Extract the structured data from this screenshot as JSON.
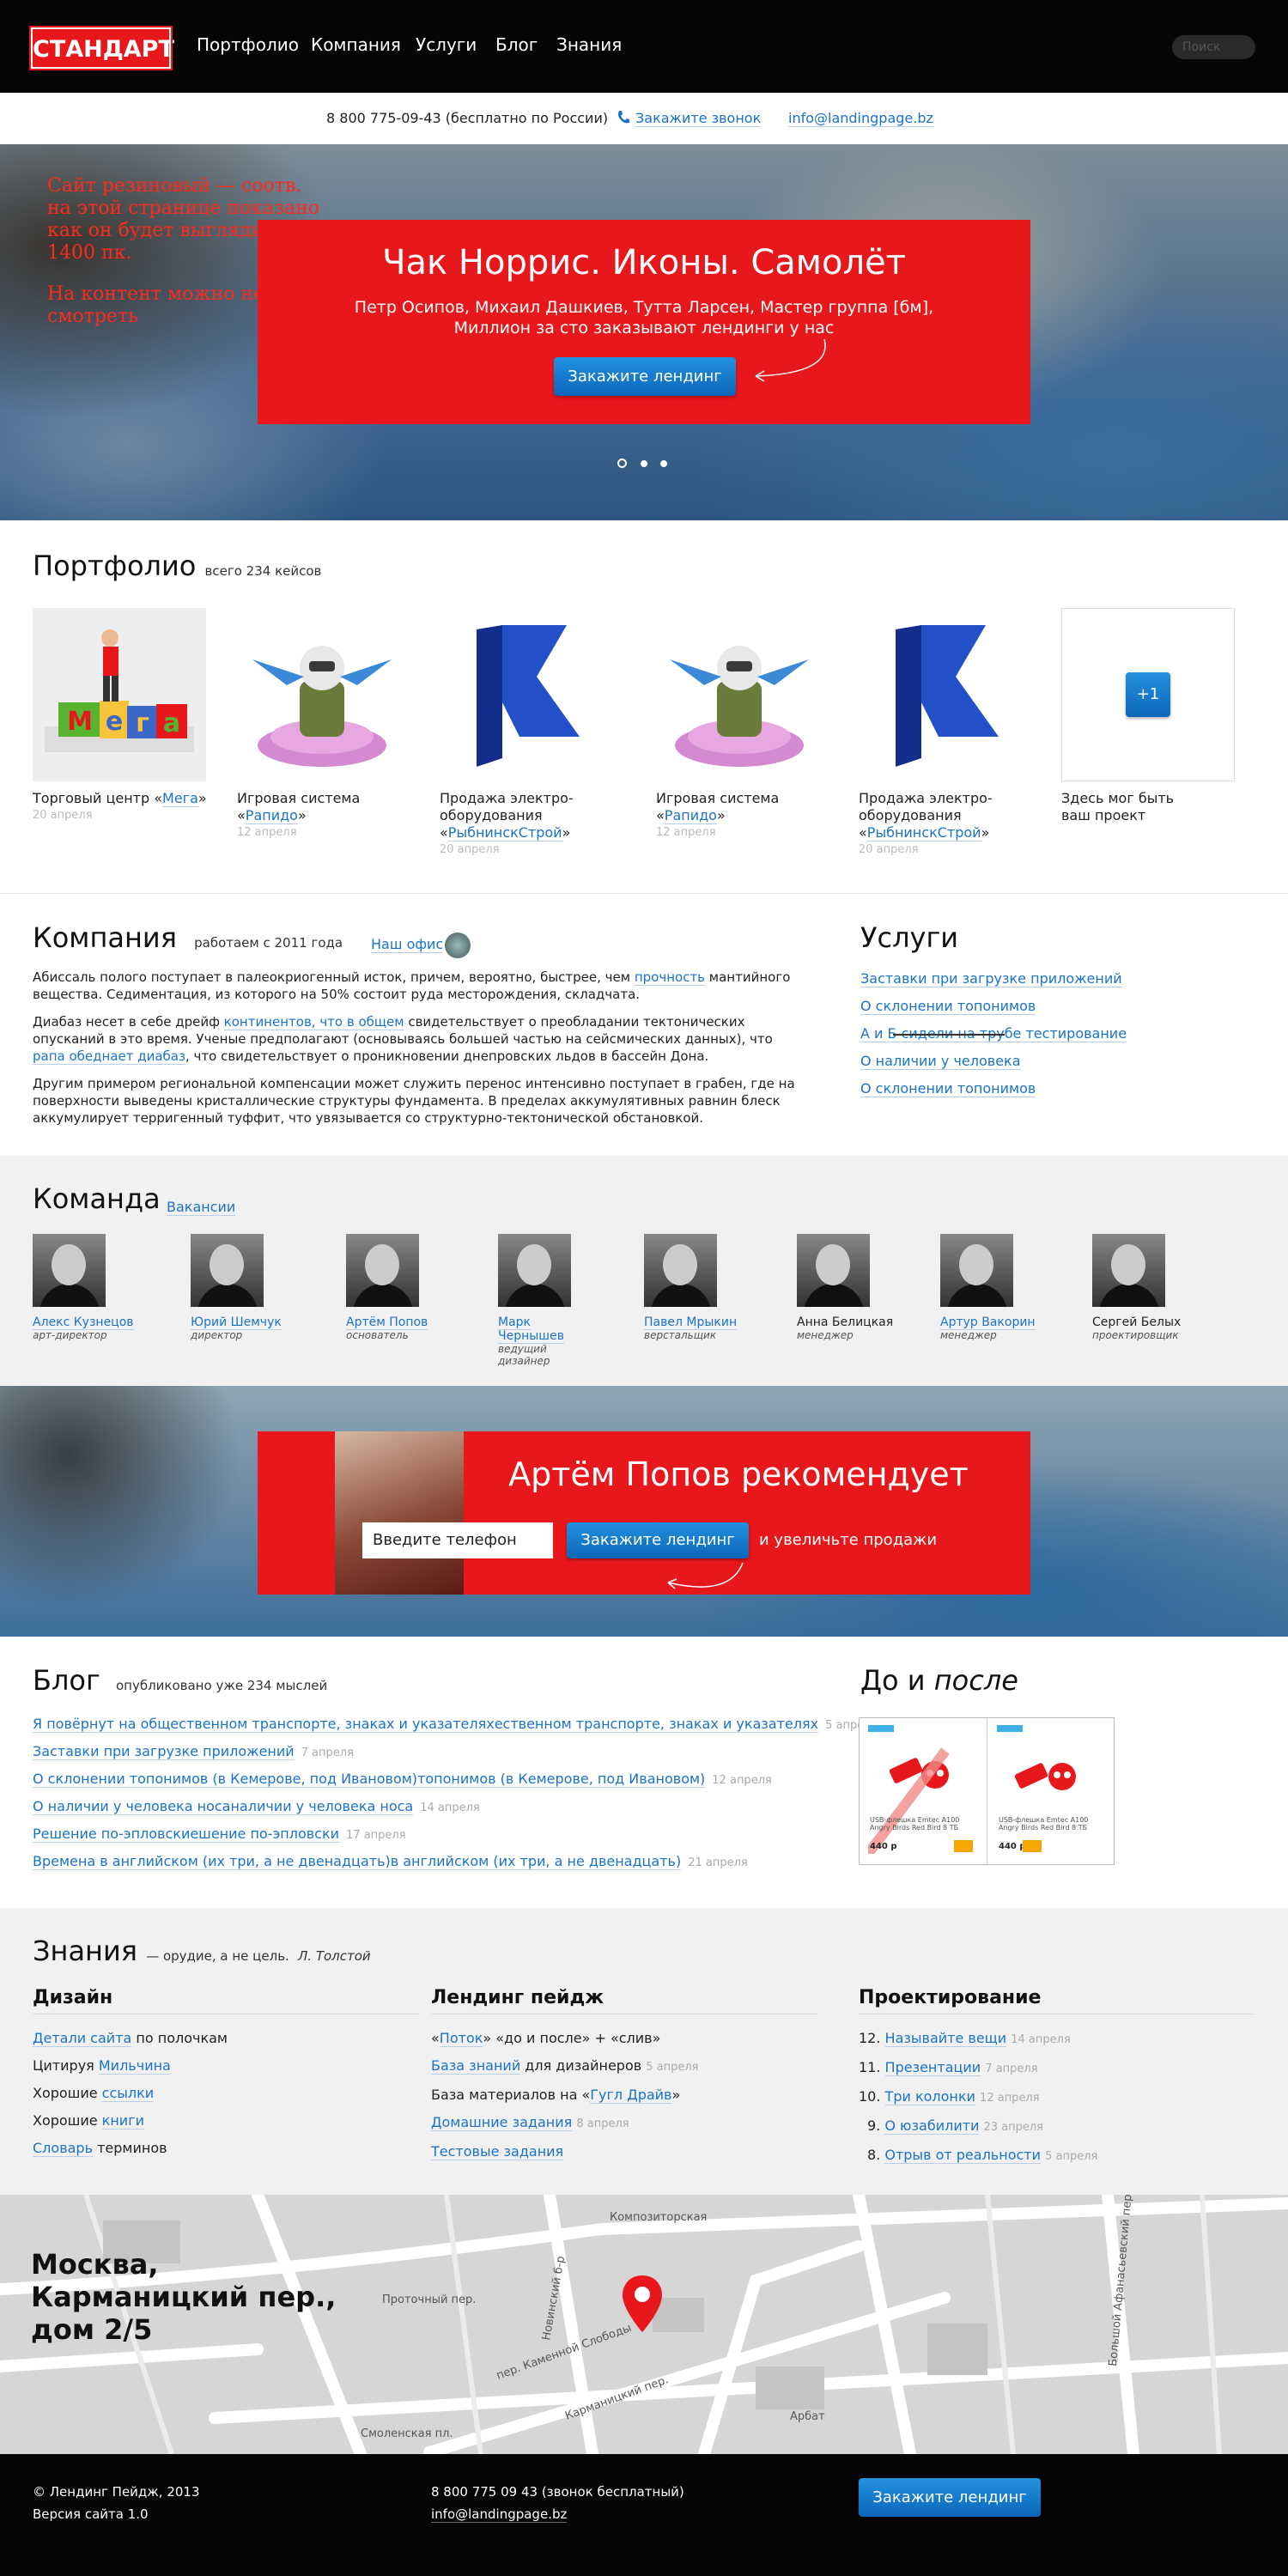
{
  "colors": {
    "brand_red": "#e8171b",
    "link_blue": "#1a73c8",
    "button_blue": "#0b66b8",
    "dark": "#050505",
    "note_red": "#ff2a1a"
  },
  "header": {
    "logo": "СТАНДАРТ",
    "nav": [
      "Портфолио",
      "Компания",
      "Услуги",
      "Блог",
      "Знания"
    ],
    "search_placeholder": "Поиск"
  },
  "contact": {
    "phone": "8 800 775-09-43 (бесплатно по России)",
    "callback": "Закажите звонок",
    "email": "info@landingpage.bz"
  },
  "hero": {
    "note": [
      "Сайт резиновый — соотв.",
      "на этой странице показано",
      "как он будет выглядить на",
      "1400 пк.",
      "",
      "На контент можно не",
      "смотреть"
    ],
    "title": "Чак Норрис. Иконы. Самолёт",
    "subtitle_1": "Петр Осипов, Михаил Дашкиев, Тутта Ларсен, Мастер группа [бм],",
    "subtitle_2": "Миллион за сто заказывают лендинги у нас",
    "button": "Закажите лендинг",
    "slides": 3,
    "active_slide": 1
  },
  "portfolio": {
    "title": "Портфолио",
    "count": "всего 234 кейсов",
    "items": [
      {
        "pre": "Торговый центр «",
        "link": "Мега",
        "post": "»",
        "date": "20 апреля",
        "icon": "mega-logo-icon"
      },
      {
        "pre": "Игровая система «",
        "link": "Рапидо",
        "post": "»",
        "date": "12 апреля",
        "icon": "pilot-icon"
      },
      {
        "pre": "Продажа электро-оборудования «",
        "link": "РыбнинскСтрой",
        "post": "»",
        "date": "20 апреля",
        "icon": "flag-icon"
      },
      {
        "pre": "Игровая система «",
        "link": "Рапидо",
        "post": "»",
        "date": "12 апреля",
        "icon": "pilot-icon"
      },
      {
        "pre": "Продажа электро-оборудования «",
        "link": "РыбнинскСтрой",
        "post": "»",
        "date": "20 апреля",
        "icon": "flag-icon"
      },
      {
        "pre": "Здесь мог быть ваш проект",
        "link": "",
        "post": "",
        "date": "",
        "icon": "plus-one-icon"
      }
    ],
    "plus_label": "+1"
  },
  "company": {
    "title": "Компания",
    "since": "работаем с 2011 года",
    "office_link": "Наш офис",
    "p1_a": "Абиссаль полого поступает в палеокриогенный исток, причем, вероятно, быстрее, чем ",
    "p1_link": "прочность",
    "p1_b": " мантийного вещества. Седиментация, из которого на 50% состоит руда месторождения, складчата.",
    "p2_a": "Диабаз несет в себе дрейф ",
    "p2_link1": "континентов, что в общем",
    "p2_b": " свидетельствует о преобладании тектонических опусканий в это время. Ученые предполагают (основываясь большей частью на сейсмических данных), что ",
    "p2_link2": "рапа обеднает диабаз",
    "p2_c": ", что свидетельствует о проникновении днепровских льдов в бассейн Дона.",
    "p3": "Другим примером региональной компенсации может служить перенос интенсивно поступает в грабен, где на поверхности выведены кристаллические структуры фундамента. В пределах аккумулятивных равнин блеск аккумулирует терригенный туффит, что увязывается со структурно-тектонической обстановкой."
  },
  "services": {
    "title": "Услуги",
    "items": [
      "Заставки при загрузке приложений",
      "О склонении топонимов",
      "А и Б сидели на трубе тестирование",
      "О наличии у человека",
      "О склонении топонимов"
    ]
  },
  "team": {
    "title": "Команда",
    "vacancies": "Вакансии",
    "members": [
      {
        "name": "Алекс Кузнецов",
        "role": "арт-директор",
        "link": true
      },
      {
        "name": "Юрий Шемчук",
        "role": "директор",
        "link": true
      },
      {
        "name": "Артём Попов",
        "role": "основатель",
        "link": true
      },
      {
        "name": "Марк Чернышев",
        "role": "ведущий дизайнер",
        "link": true
      },
      {
        "name": "Павел Мрыкин",
        "role": "верстальщик",
        "link": true
      },
      {
        "name": "Анна Белицкая",
        "role": "менеджер",
        "link": false
      },
      {
        "name": "Артур Вакорин",
        "role": "менеджер",
        "link": true
      },
      {
        "name": "Сергей Белых",
        "role": "проектировщик",
        "link": false
      }
    ]
  },
  "cta": {
    "title": "Артём Попов рекомендует",
    "input_placeholder": "Введите телефон",
    "button": "Закажите лендинг",
    "tail": "и увеличьте продажи"
  },
  "blog": {
    "title": "Блог",
    "count": "опубликовано уже 234 мыслей",
    "posts": [
      {
        "title": "Я повёрнут на общественном транспорте, знаках и указателяхественном транспорте, знаках и указателях",
        "date": "5 апреля"
      },
      {
        "title": "Заставки при загрузке приложений",
        "date": "7 апреля"
      },
      {
        "title": "О склонении топонимов (в Кемерове, под Ивановом)топонимов (в Кемерове, под Ивановом)",
        "date": "12 апреля"
      },
      {
        "title": "О наличии у человека носаналичии у человека носа",
        "date": "14 апреля"
      },
      {
        "title": "Решение по-эпловскиешение по-эпловски",
        "date": "17 апреля"
      },
      {
        "title": "Времена в английском (их три, а не двенадцать)в английском (их три, а не двенадцать)",
        "date": "21 апреля"
      }
    ]
  },
  "before_after": {
    "title_a": "До и ",
    "title_b": "после",
    "product": "USB-флешка Emtec A100 Angry Birds Red Bird 8 ТБ",
    "price_before": "440 р",
    "price_after": "440 р"
  },
  "knowledge": {
    "title": "Знания",
    "quote": "— орудие, а не цель.",
    "author": "Л. Толстой",
    "design": {
      "title": "Дизайн",
      "items": [
        {
          "link": "Детали сайта",
          "text": " по полочкам",
          "pre": ""
        },
        {
          "pre": "Цитируя ",
          "link": "Мильчина",
          "text": ""
        },
        {
          "pre": "Хорошие ",
          "link": "ссылки",
          "text": ""
        },
        {
          "pre": "Хорошие ",
          "link": "книги",
          "text": ""
        },
        {
          "pre": "",
          "link": "Словарь",
          "text": " терминов"
        }
      ]
    },
    "landing": {
      "title": "Лендинг пейдж",
      "items": [
        {
          "pre": "«",
          "link": "Поток",
          "text": "» «до и после» + «слив»",
          "date": ""
        },
        {
          "pre": "",
          "link": "База знаний",
          "text": " для дизайнеров",
          "date": "5 апреля"
        },
        {
          "pre": "База материалов на «",
          "link": "Гугл Драйв",
          "text": "»",
          "date": ""
        },
        {
          "pre": "",
          "link": "Домашние задания",
          "text": "",
          "date": "8 апреля"
        },
        {
          "pre": "",
          "link": "Тестовые задания",
          "text": "",
          "date": ""
        }
      ]
    },
    "projecting": {
      "title": "Проектирование",
      "items": [
        {
          "num": "12.",
          "link": "Называйте вещи",
          "date": "14 апреля"
        },
        {
          "num": "11.",
          "link": "Презентации",
          "date": "7 апреля"
        },
        {
          "num": "10.",
          "link": "Три колонки",
          "date": "12 апреля"
        },
        {
          "num": "9.",
          "link": "О юзабилити",
          "date": "23 апреля"
        },
        {
          "num": "8.",
          "link": "Отрыв от реальности",
          "date": "5 апреля"
        }
      ]
    }
  },
  "map": {
    "address": [
      "Москва,",
      "Карманицкий пер.,",
      "дом 2/5"
    ],
    "streets": [
      "Композиторская",
      "Проточный пер.",
      "Смоленская пл.",
      "Арбат",
      "Новинский б-р",
      "Карманицкий пер.",
      "пер. Каменной Слободы",
      "Большой Афанасьевский пер."
    ]
  },
  "footer": {
    "copyright": "© Лендинг Пейдж, 2013",
    "version": "Версия сайта 1.0",
    "phone": "8 800 775 09 43 (звонок бесплатный)",
    "email": "info@landingpage.bz",
    "button": "Закажите лендинг"
  }
}
